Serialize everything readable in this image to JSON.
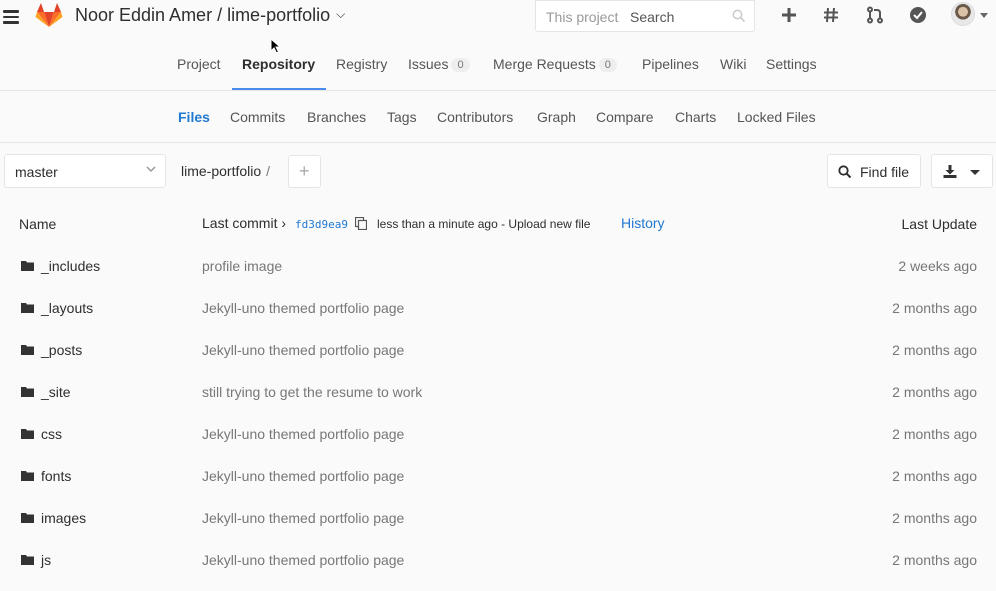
{
  "header": {
    "project_title": "Noor Eddin Amer / lime-portfolio",
    "search_scope": "This project",
    "search_placeholder": "Search",
    "icons": [
      "plus-icon",
      "hash-icon",
      "merge-request-icon",
      "todo-check-icon"
    ]
  },
  "main_nav": {
    "tabs": [
      {
        "label": "Project"
      },
      {
        "label": "Repository",
        "active": true
      },
      {
        "label": "Registry"
      },
      {
        "label": "Issues",
        "count": "0"
      },
      {
        "label": "Merge Requests",
        "count": "0"
      },
      {
        "label": "Pipelines"
      },
      {
        "label": "Wiki"
      },
      {
        "label": "Settings"
      }
    ]
  },
  "sub_nav": {
    "tabs": [
      {
        "label": "Files",
        "active": true
      },
      {
        "label": "Commits"
      },
      {
        "label": "Branches"
      },
      {
        "label": "Tags"
      },
      {
        "label": "Contributors"
      },
      {
        "label": "Graph"
      },
      {
        "label": "Compare"
      },
      {
        "label": "Charts"
      },
      {
        "label": "Locked Files"
      }
    ]
  },
  "tree": {
    "branch": "master",
    "path": "lime-portfolio",
    "path_sep": "/",
    "find_file": "Find file",
    "columns": {
      "name": "Name",
      "last_commit": "Last commit",
      "last_update": "Last Update"
    },
    "commit_sha": "fd3d9ea9",
    "commit_message": "less than a minute ago - Upload new file",
    "history": "History",
    "rows": [
      {
        "name": "_includes",
        "message": "profile image",
        "time": "2 weeks ago"
      },
      {
        "name": "_layouts",
        "message": "Jekyll-uno themed portfolio page",
        "time": "2 months ago"
      },
      {
        "name": "_posts",
        "message": "Jekyll-uno themed portfolio page",
        "time": "2 months ago"
      },
      {
        "name": "_site",
        "message": "still trying to get the resume to work",
        "time": "2 months ago"
      },
      {
        "name": "css",
        "message": "Jekyll-uno themed portfolio page",
        "time": "2 months ago"
      },
      {
        "name": "fonts",
        "message": "Jekyll-uno themed portfolio page",
        "time": "2 months ago"
      },
      {
        "name": "images",
        "message": "Jekyll-uno themed portfolio page",
        "time": "2 months ago"
      },
      {
        "name": "js",
        "message": "Jekyll-uno themed portfolio page",
        "time": "2 months ago"
      }
    ]
  },
  "colors": {
    "accent": "#1f78d1",
    "tab_underline": "#4a8bee",
    "logo": "#e24329"
  }
}
